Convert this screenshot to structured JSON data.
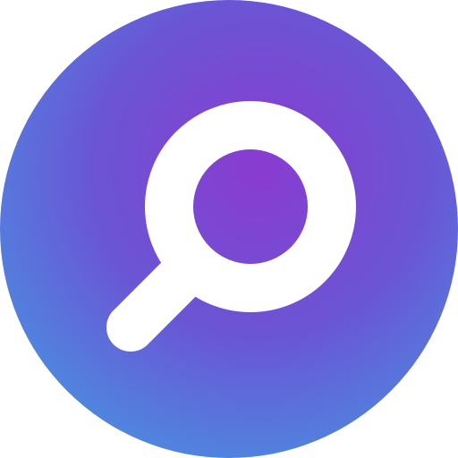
{
  "icon": {
    "name": "search-icon",
    "colors": {
      "gradient_center": "#8a3bd0",
      "gradient_mid": "#6b55d6",
      "gradient_edge": "#3fa0e4",
      "glyph": "#ffffff"
    }
  }
}
